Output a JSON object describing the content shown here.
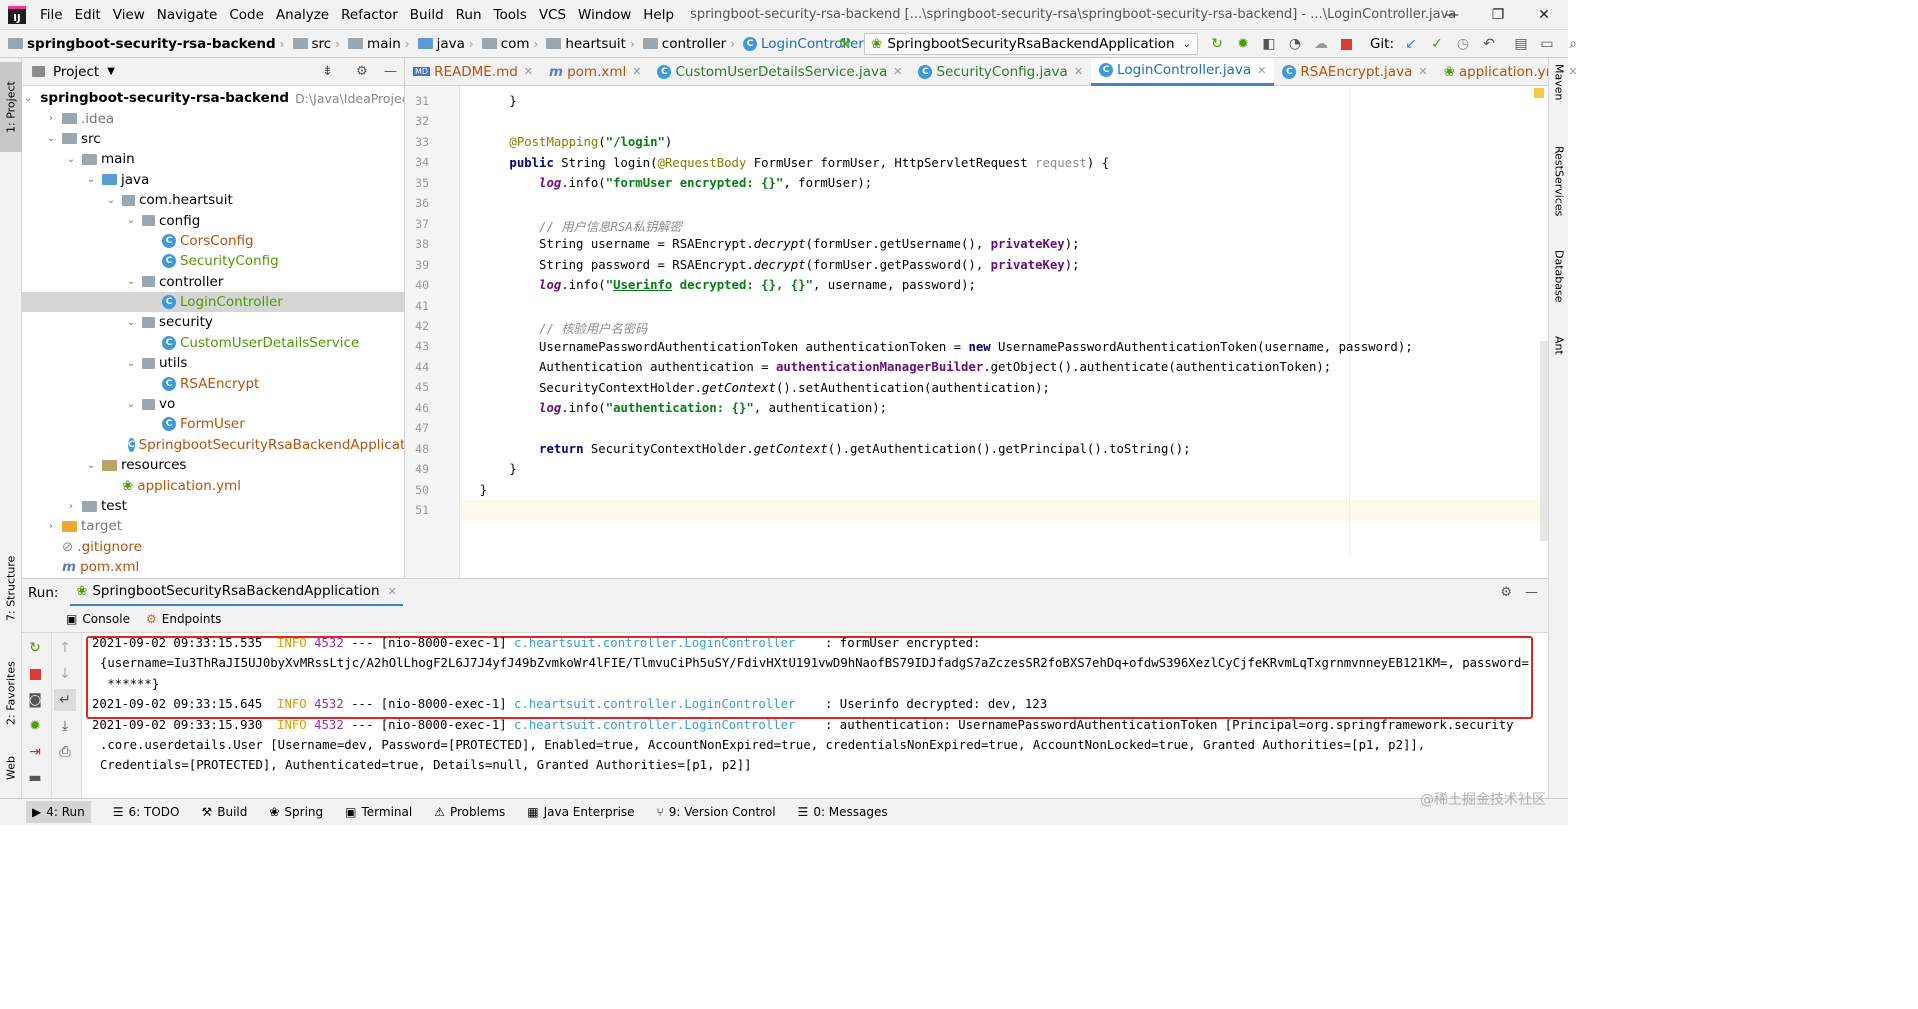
{
  "menubar": {
    "logo": "IJ",
    "items": [
      "File",
      "Edit",
      "View",
      "Navigate",
      "Code",
      "Analyze",
      "Refactor",
      "Build",
      "Run",
      "Tools",
      "VCS",
      "Window",
      "Help"
    ],
    "title": "springboot-security-rsa-backend [...\\springboot-security-rsa\\springboot-security-rsa-backend] - ...\\LoginController.java"
  },
  "navbar": {
    "breadcrumbs": [
      "springboot-security-rsa-backend",
      "src",
      "main",
      "java",
      "com",
      "heartsuit",
      "controller",
      "LoginController"
    ],
    "run_config": "SpringbootSecurityRsaBackendApplication",
    "git_label": "Git:"
  },
  "left_stripe": {
    "project": "1: Project",
    "structure": "7: Structure",
    "favorites": "2: Favorites",
    "web": "Web"
  },
  "right_stripe": {
    "maven": "Maven",
    "rest": "RestServices",
    "database": "Database",
    "ant": "Ant"
  },
  "project_panel": {
    "title": "Project",
    "root_name": "springboot-security-rsa-backend",
    "root_path": "D:\\Java\\IdeaProjects\\c",
    "tree": [
      {
        "label": ".idea",
        "depth": 1,
        "arrow": "›",
        "icon": "folder",
        "color": "gray"
      },
      {
        "label": "src",
        "depth": 1,
        "arrow": "⌄",
        "icon": "folder",
        "color": "black"
      },
      {
        "label": "main",
        "depth": 2,
        "arrow": "⌄",
        "icon": "folder",
        "color": "black"
      },
      {
        "label": "java",
        "depth": 3,
        "arrow": "⌄",
        "icon": "folder-blue",
        "color": "black"
      },
      {
        "label": "com.heartsuit",
        "depth": 4,
        "arrow": "⌄",
        "icon": "package",
        "color": "black"
      },
      {
        "label": "config",
        "depth": 5,
        "arrow": "⌄",
        "icon": "package",
        "color": "black"
      },
      {
        "label": "CorsConfig",
        "depth": 6,
        "arrow": "",
        "icon": "class",
        "color": "orange"
      },
      {
        "label": "SecurityConfig",
        "depth": 6,
        "arrow": "",
        "icon": "class",
        "color": "green"
      },
      {
        "label": "controller",
        "depth": 5,
        "arrow": "⌄",
        "icon": "package",
        "color": "black"
      },
      {
        "label": "LoginController",
        "depth": 6,
        "arrow": "",
        "icon": "class",
        "color": "green",
        "selected": true
      },
      {
        "label": "security",
        "depth": 5,
        "arrow": "⌄",
        "icon": "package",
        "color": "black"
      },
      {
        "label": "CustomUserDetailsService",
        "depth": 6,
        "arrow": "",
        "icon": "class",
        "color": "green"
      },
      {
        "label": "utils",
        "depth": 5,
        "arrow": "⌄",
        "icon": "package",
        "color": "black"
      },
      {
        "label": "RSAEncrypt",
        "depth": 6,
        "arrow": "",
        "icon": "class",
        "color": "orange"
      },
      {
        "label": "vo",
        "depth": 5,
        "arrow": "⌄",
        "icon": "package",
        "color": "black"
      },
      {
        "label": "FormUser",
        "depth": 6,
        "arrow": "",
        "icon": "class",
        "color": "orange"
      },
      {
        "label": "SpringbootSecurityRsaBackendApplicat",
        "depth": 5,
        "arrow": "",
        "icon": "spring-class",
        "color": "orange"
      },
      {
        "label": "resources",
        "depth": 3,
        "arrow": "⌄",
        "icon": "folder-res",
        "color": "black"
      },
      {
        "label": "application.yml",
        "depth": 4,
        "arrow": "",
        "icon": "yml",
        "color": "orange"
      },
      {
        "label": "test",
        "depth": 2,
        "arrow": "›",
        "icon": "folder",
        "color": "black"
      },
      {
        "label": "target",
        "depth": 1,
        "arrow": "›",
        "icon": "folder-orange",
        "color": "gray"
      },
      {
        "label": ".gitignore",
        "depth": 1,
        "arrow": "",
        "icon": "file",
        "color": "orange"
      },
      {
        "label": "pom.xml",
        "depth": 1,
        "arrow": "",
        "icon": "maven",
        "color": "orange"
      }
    ]
  },
  "tabs": [
    {
      "label": "README.md",
      "icon": "MD",
      "active": false
    },
    {
      "label": "pom.xml",
      "icon": "m",
      "active": false
    },
    {
      "label": "CustomUserDetailsService.java",
      "icon": "C",
      "active": false
    },
    {
      "label": "SecurityConfig.java",
      "icon": "C",
      "active": false
    },
    {
      "label": "LoginController.java",
      "icon": "C",
      "active": true
    },
    {
      "label": "RSAEncrypt.java",
      "icon": "C",
      "active": false
    },
    {
      "label": "application.yml",
      "icon": "yml",
      "active": false
    }
  ],
  "editor": {
    "line_numbers": [
      "31",
      "32",
      "33",
      "34",
      "35",
      "36",
      "37",
      "38",
      "39",
      "40",
      "41",
      "42",
      "43",
      "44",
      "45",
      "46",
      "47",
      "48",
      "49",
      "50",
      "51"
    ]
  },
  "run_panel": {
    "label": "Run:",
    "config_tab": "SpringbootSecurityRsaBackendApplication",
    "console_tab": "Console",
    "endpoints_tab": "Endpoints"
  },
  "console": {
    "lines": [
      {
        "ts": "2021-09-02 09:33:15.535",
        "level": "INFO",
        "pid": "4532",
        "thread": "--- [nio-8000-exec-1]",
        "logger": "c.heartsuit.controller.LoginController",
        "msg": "   : formUser encrypted:"
      },
      {
        "cont": "{username=Iu3ThRaJI5UJ0byXvMRssLtjc/A2hOlLhogF2L6J7J4yfJ49bZvmkoWr4lFIE/TlmvuCiPh5uSY/FdivHXtU191vwD9hNaofBS79IDJfadgS7aZczesSR2foBXS7ehDq+ofdwS396XezlCyCjfeKRvmLqTxgrnmvnneyEB121KM=, password="
      },
      {
        "cont": " ******}"
      },
      {
        "ts": "2021-09-02 09:33:15.645",
        "level": "INFO",
        "pid": "4532",
        "thread": "--- [nio-8000-exec-1]",
        "logger": "c.heartsuit.controller.LoginController",
        "msg": "   : Userinfo decrypted: dev, 123"
      },
      {
        "ts": "2021-09-02 09:33:15.930",
        "level": "INFO",
        "pid": "4532",
        "thread": "--- [nio-8000-exec-1]",
        "logger": "c.heartsuit.controller.LoginController",
        "msg": "   : authentication: UsernamePasswordAuthenticationToken [Principal=org.springframework.security"
      },
      {
        "cont": ".core.userdetails.User [Username=dev, Password=[PROTECTED], Enabled=true, AccountNonExpired=true, credentialsNonExpired=true, AccountNonLocked=true, Granted Authorities=[p1, p2]],"
      },
      {
        "cont": "Credentials=[PROTECTED], Authenticated=true, Details=null, Granted Authorities=[p1, p2]]"
      }
    ]
  },
  "bottombar": {
    "tabs": [
      {
        "label": "4: Run",
        "icon": "▶"
      },
      {
        "label": "6: TODO",
        "icon": "☰"
      },
      {
        "label": "Build",
        "icon": "⚒"
      },
      {
        "label": "Spring",
        "icon": "❀"
      },
      {
        "label": "Terminal",
        "icon": "▣"
      },
      {
        "label": "Problems",
        "icon": "⚠"
      },
      {
        "label": "Java Enterprise",
        "icon": "▦"
      },
      {
        "label": "9: Version Control",
        "icon": "⑂"
      },
      {
        "label": "0: Messages",
        "icon": "☰"
      }
    ],
    "watermark": "@稀土掘金技术社区"
  },
  "colors": {
    "accent": "#4083c9",
    "highlight_box": "#e82222",
    "info": "#d69e00",
    "logger": "#3a9dd1"
  }
}
